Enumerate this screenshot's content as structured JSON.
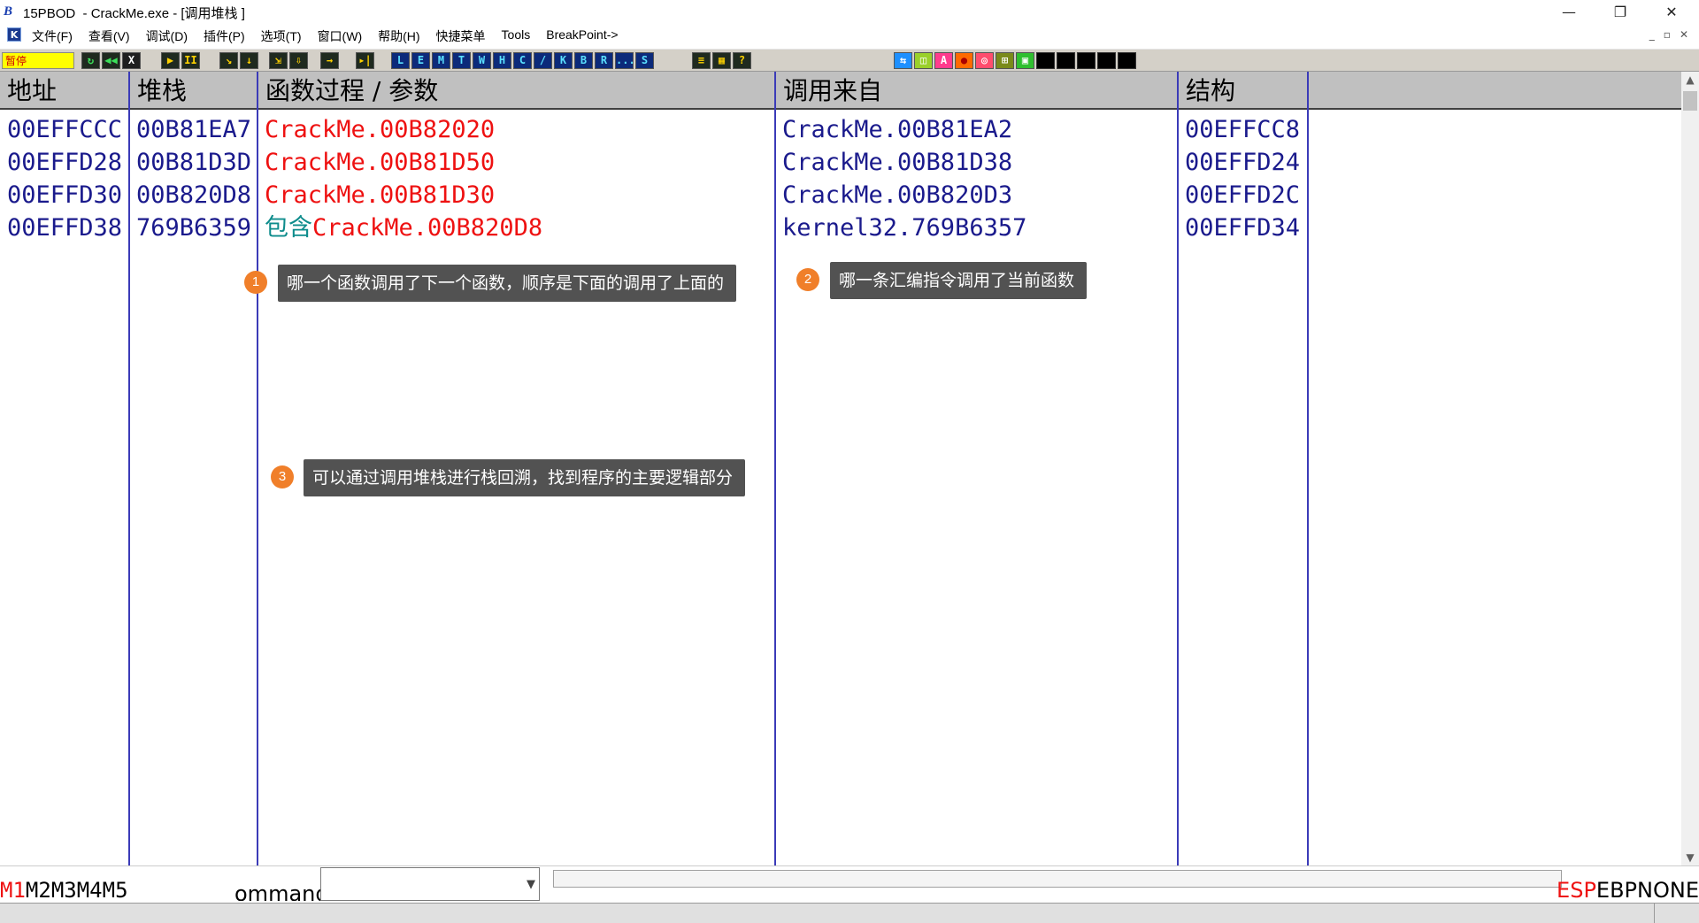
{
  "window": {
    "app_icon": "B",
    "title": "15PBOD  - CrackMe.exe - [调用堆栈 ]",
    "controls": {
      "minimize": "—",
      "restore": "❐",
      "close": "✕"
    }
  },
  "menu": {
    "k_icon": "K",
    "items": [
      "文件(F)",
      "查看(V)",
      "调试(D)",
      "插件(P)",
      "选项(T)",
      "窗口(W)",
      "帮助(H)",
      "快捷菜单",
      "Tools",
      "BreakPoint->"
    ],
    "mdi_controls": [
      "_",
      "▫",
      "✕"
    ]
  },
  "toolbar": {
    "status": "暂停",
    "group1": [
      "↻",
      "◀◀",
      "X"
    ],
    "group2": [
      "▶",
      "II"
    ],
    "group3": [
      "↘",
      "↓"
    ],
    "group4": [
      "⇲",
      "⇩"
    ],
    "group5": [
      "→"
    ],
    "group6": [
      "▸|"
    ],
    "letters": [
      "L",
      "E",
      "M",
      "T",
      "W",
      "H",
      "C",
      "/",
      "K",
      "B",
      "R",
      "...",
      "S"
    ],
    "group7": [
      "≡",
      "▦",
      "?"
    ],
    "plugins": [
      "⇆",
      "◫",
      "A",
      "●",
      "◎",
      "⊞",
      "▣",
      "",
      "",
      "",
      "",
      ""
    ],
    "colors": {
      "blue": "#1e90ff",
      "pink": "#ff3b8d",
      "green": "#2fbf2f",
      "orange": "#ff6a00",
      "olive": "#7a8a1a",
      "black": "#000000"
    }
  },
  "table": {
    "columns": [
      "地址",
      "堆栈",
      "函数过程 / 参数",
      "调用来自",
      "结构"
    ],
    "rows": [
      {
        "address": "00EFFCCC",
        "stack": "00B81EA7",
        "proc_prefix": "",
        "proc": "CrackMe.00B82020",
        "called_from": "CrackMe.00B81EA2",
        "frame": "00EFFCC8"
      },
      {
        "address": "00EFFD28",
        "stack": "00B81D3D",
        "proc_prefix": "",
        "proc": "CrackMe.00B81D50",
        "called_from": "CrackMe.00B81D38",
        "frame": "00EFFD24"
      },
      {
        "address": "00EFFD30",
        "stack": "00B820D8",
        "proc_prefix": "",
        "proc": "CrackMe.00B81D30",
        "called_from": "CrackMe.00B820D3",
        "frame": "00EFFD2C"
      },
      {
        "address": "00EFFD38",
        "stack": "769B6359",
        "proc_prefix": "包含",
        "proc": "CrackMe.00B820D8",
        "called_from": "kernel32.769B6357",
        "frame": "00EFFD34"
      }
    ]
  },
  "annotations": [
    {
      "number": "1",
      "text": "哪一个函数调用了下一个函数，顺序是下面的调用了上面的"
    },
    {
      "number": "2",
      "text": "哪一条汇编指令调用了当前函数"
    },
    {
      "number": "3",
      "text": "可以通过调用堆栈进行栈回溯，找到程序的主要逻辑部分"
    }
  ],
  "bottom": {
    "m_tabs": [
      "M1",
      "M2",
      "M3",
      "M4",
      "M5"
    ],
    "command_label": "ommand",
    "command_value": "",
    "registers": [
      "ESP",
      "EBP",
      "NONE"
    ],
    "active_register": "ESP"
  },
  "scrollbar": {
    "up": "▲",
    "down": "▼"
  }
}
